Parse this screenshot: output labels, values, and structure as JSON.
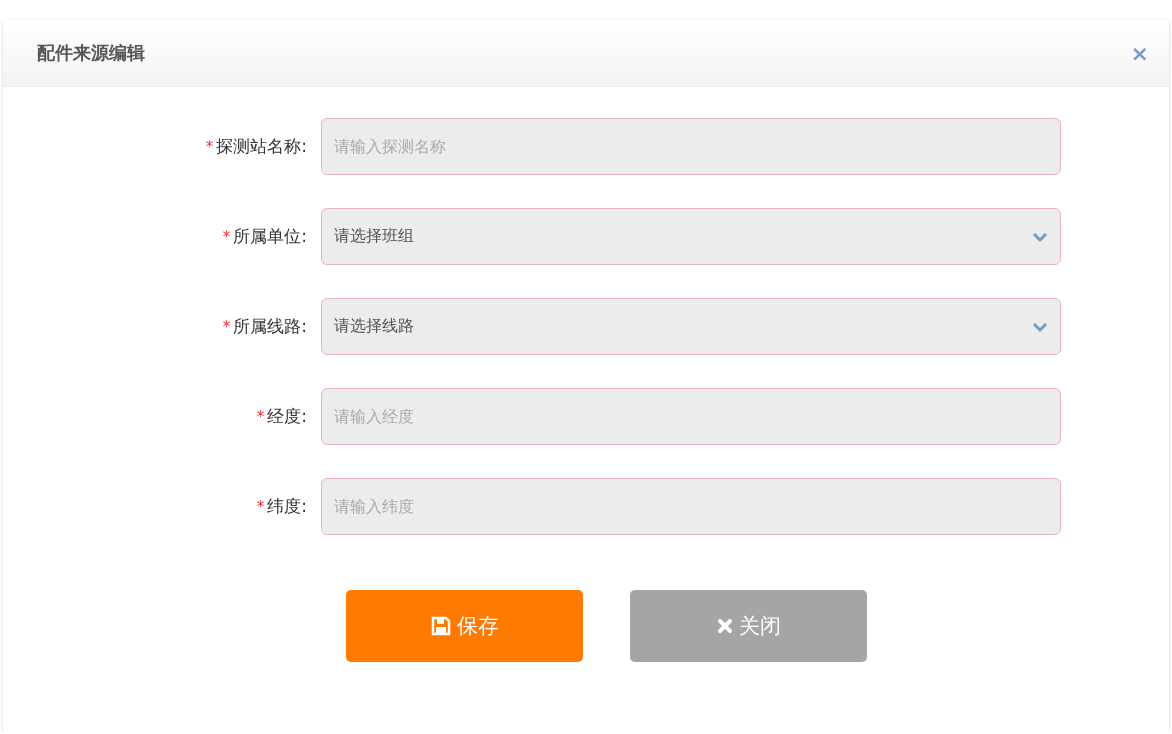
{
  "dialog": {
    "title": "配件来源编辑",
    "close_icon": "×"
  },
  "fields": [
    {
      "kind": "text",
      "label": "探测站名称:",
      "required_mark": "*",
      "placeholder": "请输入探测名称"
    },
    {
      "kind": "select",
      "label": "所属单位:",
      "required_mark": "*",
      "placeholder": "请选择班组"
    },
    {
      "kind": "select",
      "label": "所属线路:",
      "required_mark": "*",
      "placeholder": "请选择线路"
    },
    {
      "kind": "text",
      "label": "经度:",
      "required_mark": "*",
      "placeholder": "请输入经度"
    },
    {
      "kind": "text",
      "label": "纬度:",
      "required_mark": "*",
      "placeholder": "请输入纬度"
    }
  ],
  "buttons": [
    {
      "kind": "save",
      "label": "保存"
    },
    {
      "kind": "close",
      "label": "关闭"
    }
  ]
}
